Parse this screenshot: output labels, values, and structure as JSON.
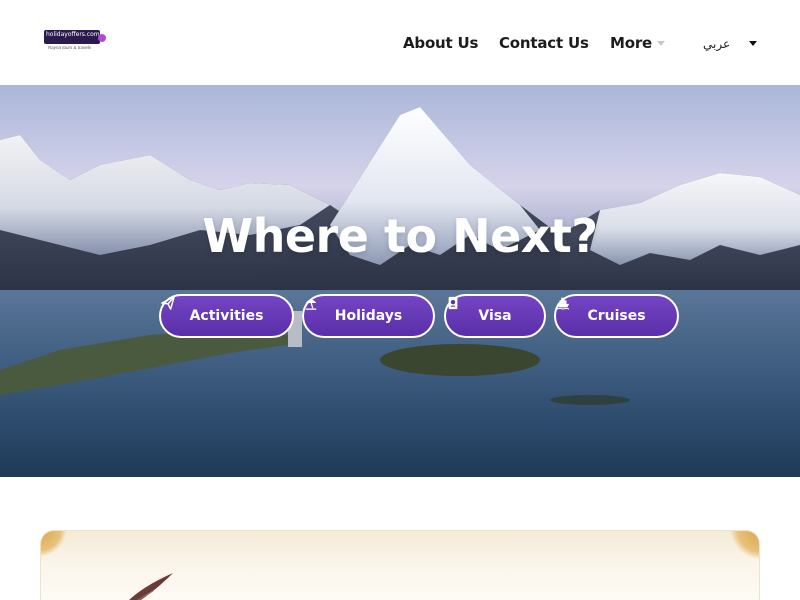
{
  "header": {
    "logo": {
      "name": "holidayoffers.com",
      "tagline": "Rayna tours & travels"
    },
    "nav": {
      "about": "About Us",
      "contact": "Contact Us",
      "more": "More"
    },
    "language": "عربي"
  },
  "hero": {
    "title": "Where to Next?",
    "categories": [
      {
        "label": "Activities",
        "icon": "paper-plane-icon"
      },
      {
        "label": "Holidays",
        "icon": "beach-umbrella-icon"
      },
      {
        "label": "Visa",
        "icon": "passport-icon"
      },
      {
        "label": "Cruises",
        "icon": "ship-icon"
      }
    ]
  },
  "colors": {
    "accent": "#5a2fa8",
    "accent_light": "#7444c4",
    "text": "#1c1c1c"
  }
}
